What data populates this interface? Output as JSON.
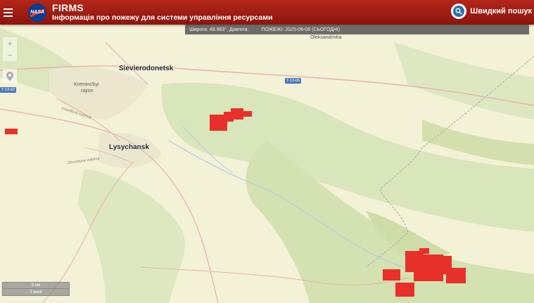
{
  "header": {
    "app_title": "FIRMS",
    "app_subtitle": "Інформація про пожежу для системи управління ресурсами",
    "logo_text": "NASA",
    "search_label": "Швидкий пошук"
  },
  "status": {
    "coordinates": "Широта: 48.983°, Довгота:",
    "fires": "ПОЖЕЖІ: 2025-06-08 (СЬОГОДНІ)"
  },
  "map": {
    "zoom_in": "+",
    "zoom_out": "−",
    "labels": {
      "sievierodonetsk": "Sievierodonetsk",
      "lysychansk": "Lysychansk",
      "oleksandrivka": "Oleksandrivka",
      "kreminskyi": "Kremins'kyi",
      "rayon": "rayon",
      "road_t1306": "T-13-06",
      "road_t1302": "T-13-02",
      "street_sverdlova": "Sverdlova vulytsia",
      "street_zhovtneva": "Zhovtneva vulytsia"
    },
    "scale": {
      "km": "5 км",
      "mi": "2 милі"
    },
    "colors": {
      "fire": "#e8302a",
      "land": "#f3f1d6",
      "green": "#d5e2b4",
      "road": "#e8b3b3"
    }
  }
}
